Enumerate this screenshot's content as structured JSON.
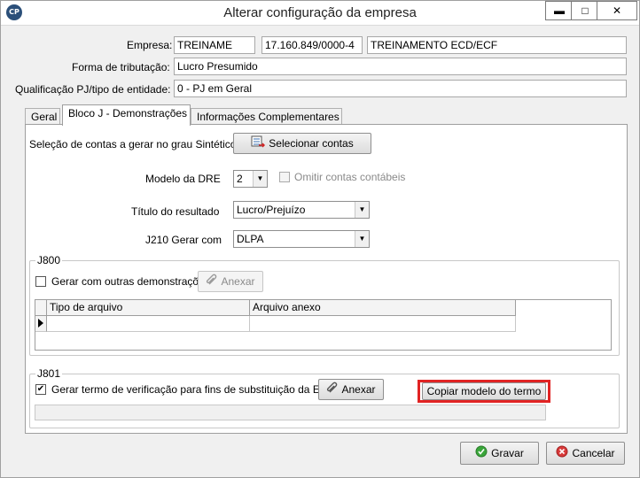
{
  "window": {
    "title": "Alterar configuração da empresa",
    "app_icon_text": "CP",
    "controls": {
      "minimize": "▬",
      "maximize": "□",
      "close": "✕"
    }
  },
  "header": {
    "empresa_label": "Empresa:",
    "empresa_code": "TREINAME",
    "empresa_cnpj": "17.160.849/0000-4",
    "empresa_name": "TREINAMENTO ECD/ECF",
    "tributacao_label": "Forma de tributação:",
    "tributacao_value": "Lucro Presumido",
    "qualificacao_label": "Qualificação PJ/tipo de entidade:",
    "qualificacao_value": "0 - PJ em Geral"
  },
  "tabs": [
    {
      "label": "Geral"
    },
    {
      "label": "Bloco J - Demonstrações"
    },
    {
      "label": "Informações Complementares"
    }
  ],
  "bloco_j": {
    "selecao_label": "Seleção de contas a gerar no grau Sintético",
    "selecionar_button": "Selecionar contas",
    "modelo_dre_label": "Modelo da DRE",
    "modelo_dre_value": "2",
    "omitir_label": "Omitir contas contábeis",
    "titulo_resultado_label": "Título do resultado",
    "titulo_resultado_value": "Lucro/Prejuízo",
    "j210_label": "J210 Gerar com",
    "j210_value": "DLPA"
  },
  "j800": {
    "group_title": "J800",
    "gerar_label": "Gerar com outras demonstrações",
    "anexar_button": "Anexar",
    "columns": [
      "Tipo de arquivo",
      "Arquivo anexo"
    ]
  },
  "j801": {
    "group_title": "J801",
    "gerar_label": "Gerar termo de verificação para fins de substituição da ECD",
    "gerar_checked": "✔",
    "anexar_button": "Anexar",
    "copiar_button": "Copiar modelo do termo",
    "highlight_color": "#e12323"
  },
  "footer": {
    "gravar_button": "Gravar",
    "cancelar_button": "Cancelar"
  }
}
